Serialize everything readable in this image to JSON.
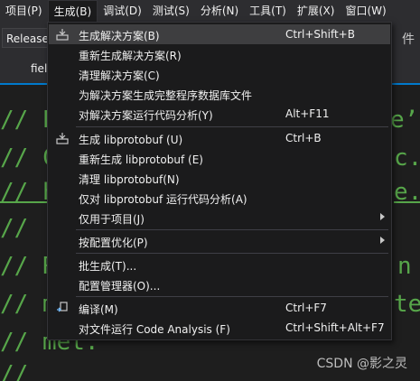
{
  "menubar": {
    "items": [
      "项目(P)",
      "生成(B)",
      "调试(D)",
      "测试(S)",
      "分析(N)",
      "工具(T)",
      "扩展(X)",
      "窗口(W)"
    ]
  },
  "toolbar": {
    "configuration": "Release",
    "partial_text": "件"
  },
  "tab": {
    "label": "fiel"
  },
  "editor": {
    "lines": [
      "// P",
      "// C",
      "// h",
      "//",
      "// R",
      "// m",
      "// met.",
      "//"
    ],
    "right_fragments": [
      "e’",
      "c.",
      "e.",
      "n",
      "te"
    ]
  },
  "dropdown": {
    "items": [
      {
        "label": "生成解决方案(B)",
        "shortcut": "Ctrl+Shift+B",
        "icon": "build-icon"
      },
      {
        "label": "重新生成解决方案(R)",
        "shortcut": ""
      },
      {
        "label": "清理解决方案(C)",
        "shortcut": ""
      },
      {
        "label": "为解决方案生成完整程序数据库文件",
        "shortcut": ""
      },
      {
        "label": "对解决方案运行代码分析(Y)",
        "shortcut": "Alt+F11"
      },
      {
        "label": "生成 libprotobuf (U)",
        "shortcut": "Ctrl+B",
        "icon": "build-icon"
      },
      {
        "label": "重新生成 libprotobuf (E)",
        "shortcut": ""
      },
      {
        "label": "清理 libprotobuf(N)",
        "shortcut": ""
      },
      {
        "label": "仅对 libprotobuf 运行代码分析(A)",
        "shortcut": ""
      },
      {
        "label": "仅用于项目(J)",
        "shortcut": "",
        "submenu": true
      },
      {
        "label": "按配置优化(P)",
        "shortcut": "",
        "submenu": true
      },
      {
        "label": "批生成(T)...",
        "shortcut": ""
      },
      {
        "label": "配置管理器(O)...",
        "shortcut": ""
      },
      {
        "label": "编译(M)",
        "shortcut": "Ctrl+F7",
        "icon": "compile-icon"
      },
      {
        "label": "对文件运行 Code Analysis (F)",
        "shortcut": "Ctrl+Shift+Alt+F7"
      }
    ]
  },
  "watermark": "CSDN @影之灵",
  "colors": {
    "accent": "#007acc",
    "comment": "#57a64a",
    "menu_bg": "#1b1b1c",
    "highlight": "#3e3e40"
  }
}
